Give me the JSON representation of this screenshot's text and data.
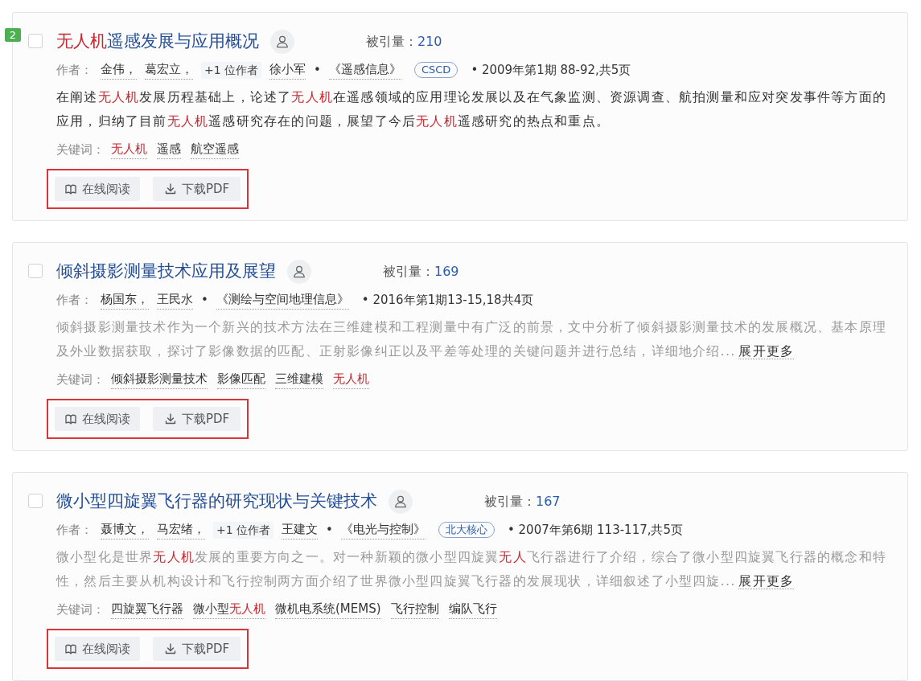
{
  "results": [
    {
      "rank_badge": "2",
      "checked": false,
      "title": [
        {
          "text": "无人机",
          "hl": true
        },
        {
          "text": "遥感发展与应用概况",
          "hl": false
        }
      ],
      "citations_label": "被引量：",
      "citations": "210",
      "authors_label": "作者：",
      "authors": [
        {
          "kind": "author",
          "text": "金伟，"
        },
        {
          "kind": "author",
          "text": "葛宏立，"
        },
        {
          "kind": "more",
          "text": "+1 位作者"
        },
        {
          "kind": "author",
          "text": "徐小军"
        }
      ],
      "separator": "•",
      "journal": "《遥感信息》",
      "journal_badge": "CSCD",
      "issue": "• 2009年第1期 88-92,共5页",
      "expanded": true,
      "abstract": [
        {
          "text": "在阐述",
          "hl": false
        },
        {
          "text": "无人机",
          "hl": true
        },
        {
          "text": "发展历程基础上，论述了",
          "hl": false
        },
        {
          "text": "无人机",
          "hl": true
        },
        {
          "text": "在遥感领域的应用理论发展以及在气象监测、资源调查、航拍测量和应对突发事件等方面的应用，归纳了目前",
          "hl": false
        },
        {
          "text": "无人机",
          "hl": true
        },
        {
          "text": "遥感研究存在的问题，展望了今后",
          "hl": false
        },
        {
          "text": "无人机",
          "hl": true
        },
        {
          "text": "遥感研究的热点和重点。",
          "hl": false
        }
      ],
      "keywords_label": "关键词：",
      "keywords": [
        [
          {
            "text": "无人机",
            "hl": true
          }
        ],
        [
          {
            "text": "遥感",
            "hl": false
          }
        ],
        [
          {
            "text": "航空遥感",
            "hl": false
          }
        ]
      ],
      "read_button": "在线阅读",
      "download_button": "下载PDF",
      "annotated": true
    },
    {
      "checked": false,
      "title": [
        {
          "text": "倾斜摄影测量技术应用及展望",
          "hl": false
        }
      ],
      "citations_label": "被引量：",
      "citations": "169",
      "authors_label": "作者：",
      "authors": [
        {
          "kind": "author",
          "text": "杨国东，"
        },
        {
          "kind": "author",
          "text": "王民水"
        }
      ],
      "separator": "•",
      "journal": "《测绘与空间地理信息》",
      "issue": "• 2016年第1期13-15,18共4页",
      "expanded": false,
      "abstract": [
        {
          "text": "倾斜摄影测量技术作为一个新兴的技术方法在三维建模和工程测量中有广泛的前景，文中分析了倾斜摄影测量技术的发展概况、基本原理及外业数据获取，探讨了影像数据的匹配、正射影像纠正以及平差等处理的关键问题并进行总结，详细地介绍...",
          "hl": false
        }
      ],
      "more_link": "展开更多",
      "keywords_label": "关键词：",
      "keywords": [
        [
          {
            "text": "倾斜摄影测量技术",
            "hl": false
          }
        ],
        [
          {
            "text": "影像匹配",
            "hl": false
          }
        ],
        [
          {
            "text": "三维建模",
            "hl": false
          }
        ],
        [
          {
            "text": "无人机",
            "hl": true
          }
        ]
      ],
      "read_button": "在线阅读",
      "download_button": "下载PDF",
      "annotated": true
    },
    {
      "checked": false,
      "title": [
        {
          "text": "微小型四旋翼飞行器的研究现状与关键技术",
          "hl": false
        }
      ],
      "citations_label": "被引量：",
      "citations": "167",
      "authors_label": "作者：",
      "authors": [
        {
          "kind": "author",
          "text": "聂博文，"
        },
        {
          "kind": "author",
          "text": "马宏绪，"
        },
        {
          "kind": "more",
          "text": "+1 位作者"
        },
        {
          "kind": "author",
          "text": "王建文"
        }
      ],
      "separator": "•",
      "journal": "《电光与控制》",
      "journal_badge": "北大核心",
      "issue": "• 2007年第6期 113-117,共5页",
      "expanded": false,
      "abstract": [
        {
          "text": "微小型化是世界",
          "hl": false
        },
        {
          "text": "无人机",
          "hl": true
        },
        {
          "text": "发展的重要方向之一。对一种新颖的微小型四旋翼",
          "hl": false
        },
        {
          "text": "无人",
          "hl": true
        },
        {
          "text": "飞行器进行了介绍，综合了微小型四旋翼飞行器的概念和特性，然后主要从机构设计和飞行控制两方面介绍了世界微小型四旋翼飞行器的发展现状，详细叙述了小型四旋...",
          "hl": false
        }
      ],
      "more_link": "展开更多",
      "keywords_label": "关键词：",
      "keywords": [
        [
          {
            "text": "四旋翼飞行器",
            "hl": false
          }
        ],
        [
          {
            "text": "微小型",
            "hl": false
          },
          {
            "text": "无人机",
            "hl": true
          }
        ],
        [
          {
            "text": "微机电系统(MEMS)",
            "hl": false
          }
        ],
        [
          {
            "text": "飞行控制",
            "hl": false
          }
        ],
        [
          {
            "text": "编队飞行",
            "hl": false
          }
        ]
      ],
      "read_button": "在线阅读",
      "download_button": "下载PDF",
      "annotated": true
    }
  ]
}
